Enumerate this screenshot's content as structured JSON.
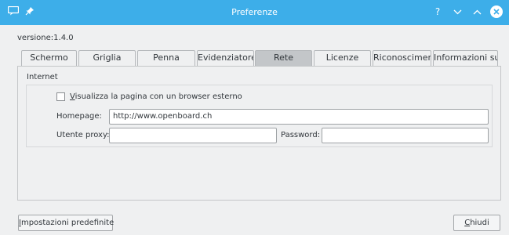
{
  "window": {
    "title": "Preferenze",
    "help_glyph": "?",
    "minimize_glyph": "⌄",
    "maximize_glyph": "⌃",
    "title_bg": "#3daee9"
  },
  "version_text": "versione:1.4.0",
  "tabs": [
    {
      "label": "Schermo"
    },
    {
      "label": "Griglia"
    },
    {
      "label": "Penna"
    },
    {
      "label": "Evidenziatore"
    },
    {
      "label": "Rete"
    },
    {
      "label": "Licenze"
    },
    {
      "label": "Riconoscimenti"
    },
    {
      "label": "Informazioni su"
    }
  ],
  "active_tab": "Rete",
  "section": {
    "title": "Internet",
    "checkbox": {
      "mnemonic": "V",
      "rest": "isualizza la pagina con un browser esterno",
      "checked": false
    },
    "homepage": {
      "label": "Homepage:",
      "value": "http://www.openboard.ch"
    },
    "proxy_user": {
      "label": "Utente proxy:",
      "value": ""
    },
    "password": {
      "label": "Password:",
      "value": ""
    }
  },
  "footer": {
    "defaults_mnemonic": "I",
    "defaults_rest": "mpostazioni predefinite",
    "close_mnemonic": "C",
    "close_rest": "hiudi"
  },
  "colors": {
    "accent": "#3daee9",
    "active_tab": "#c3c6c9",
    "window_bg": "#eff0f1"
  }
}
